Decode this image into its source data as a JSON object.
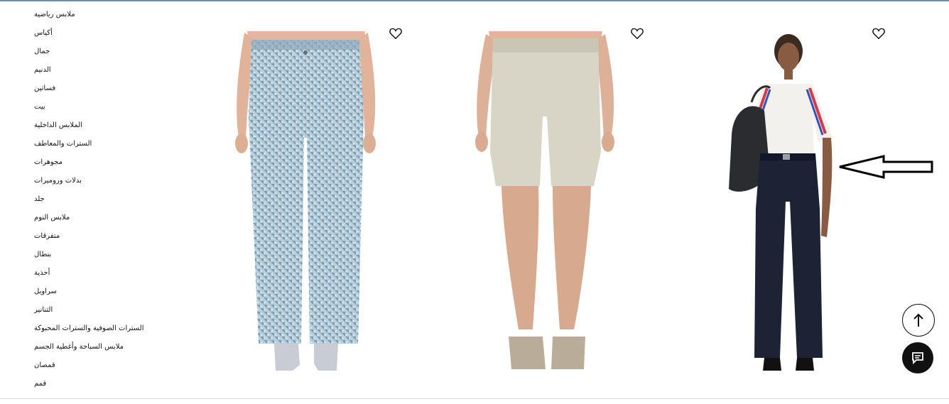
{
  "sidebar": {
    "items": [
      {
        "label": "ملابس رياضية"
      },
      {
        "label": "أكياس"
      },
      {
        "label": "جمال"
      },
      {
        "label": "الدنيم"
      },
      {
        "label": "فساتين"
      },
      {
        "label": "بيت"
      },
      {
        "label": "الملابس الداخلية"
      },
      {
        "label": "السترات والمعاطف"
      },
      {
        "label": "مجوهرات"
      },
      {
        "label": "بدلات وروميرات"
      },
      {
        "label": "جلد"
      },
      {
        "label": "ملابس النوم"
      },
      {
        "label": "متفرقات"
      },
      {
        "label": "بنطال"
      },
      {
        "label": "أحذية"
      },
      {
        "label": "سراويل"
      },
      {
        "label": "التنانير"
      },
      {
        "label": "السترات الصوفية والسترات المحبوكة"
      },
      {
        "label": "ملابس السباحة وأغطية الجسم"
      },
      {
        "label": "قمصان"
      },
      {
        "label": "قمم"
      }
    ]
  },
  "products": [
    {
      "image": "sequin-houndstooth-jeans",
      "wishlist_icon": "heart-outline-icon"
    },
    {
      "image": "khaki-shorts",
      "wishlist_icon": "heart-outline-icon"
    },
    {
      "image": "dark-denim-wide-leg-jeans",
      "wishlist_icon": "heart-outline-icon"
    }
  ],
  "floating": {
    "scroll_top_icon": "arrow-up-icon",
    "chat_icon": "chat-bubble-icon"
  },
  "colors": {
    "text": "#111111",
    "chat_bg": "#111111",
    "jeans_light": "#a9c3d3",
    "shorts": "#d8d5c6",
    "denim_dark": "#1d2335"
  }
}
